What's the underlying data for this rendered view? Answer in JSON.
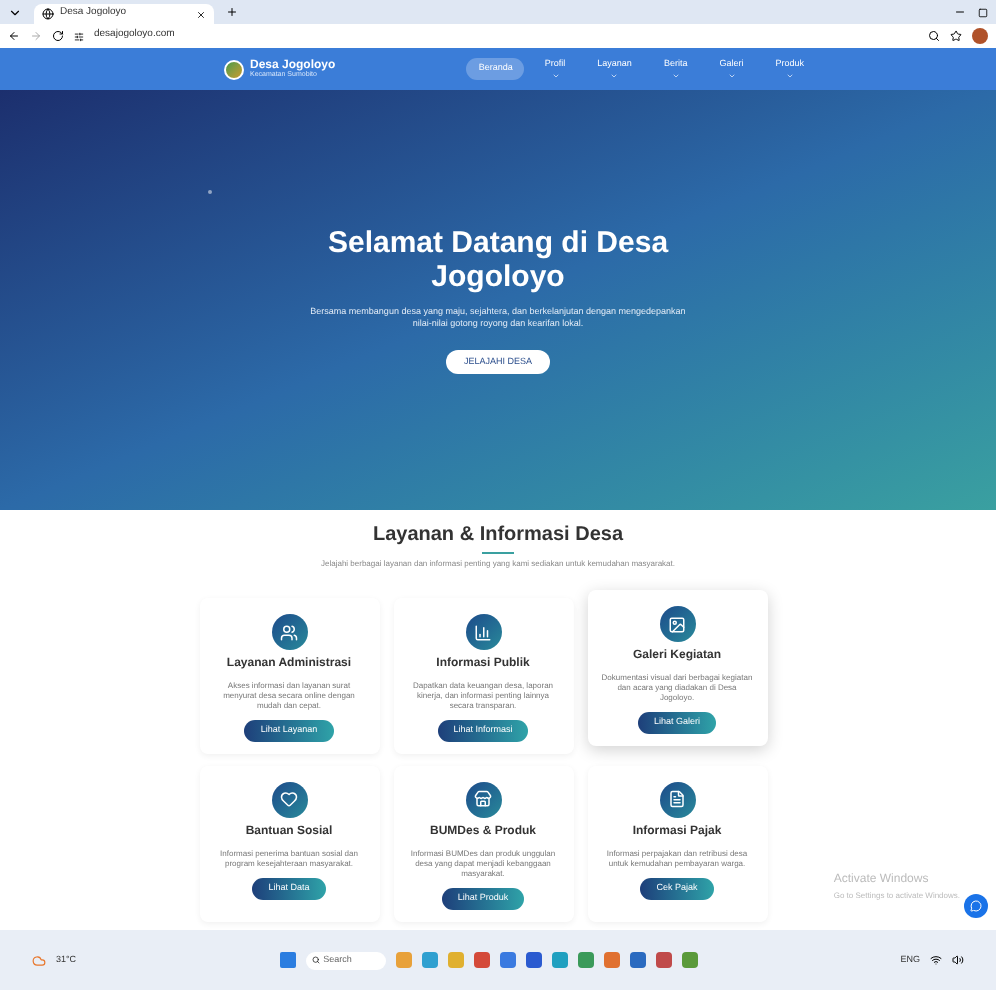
{
  "browser": {
    "tab_title": "Desa Jogoloyo",
    "url": "desajogoloyo.com"
  },
  "site": {
    "name": "Desa Jogoloyo",
    "tagline": "Kecamatan Sumobito",
    "nav": [
      {
        "label": "Beranda",
        "selected": true,
        "dropdown": false
      },
      {
        "label": "Profil",
        "selected": false,
        "dropdown": true
      },
      {
        "label": "Layanan",
        "selected": false,
        "dropdown": true
      },
      {
        "label": "Berita",
        "selected": false,
        "dropdown": true
      },
      {
        "label": "Galeri",
        "selected": false,
        "dropdown": true
      },
      {
        "label": "Produk",
        "selected": false,
        "dropdown": true
      }
    ]
  },
  "hero": {
    "title": "Selamat Datang di Desa Jogoloyo",
    "subtitle": "Bersama membangun desa yang maju, sejahtera, dan berkelanjutan dengan mengedepankan nilai-nilai gotong royong dan kearifan lokal.",
    "button": "JELAJAHI DESA"
  },
  "section": {
    "title": "Layanan & Informasi Desa",
    "subtitle": "Jelajahi berbagai layanan dan informasi penting yang kami sediakan untuk kemudahan masyarakat.",
    "cards": [
      {
        "kind": "people",
        "title": "Layanan Administrasi",
        "text": "Akses informasi dan layanan surat menyurat desa secara online dengan mudah dan cepat.",
        "button": "Lihat Layanan",
        "raised": false
      },
      {
        "kind": "chart",
        "title": "Informasi Publik",
        "text": "Dapatkan data keuangan desa, laporan kinerja, dan informasi penting lainnya secara transparan.",
        "button": "Lihat Informasi",
        "raised": false
      },
      {
        "kind": "image",
        "title": "Galeri Kegiatan",
        "text": "Dokumentasi visual dari berbagai kegiatan dan acara yang diadakan di Desa Jogoloyo.",
        "button": "Lihat Galeri",
        "raised": true
      },
      {
        "kind": "heart",
        "title": "Bantuan Sosial",
        "text": "Informasi penerima bantuan sosial dan program kesejahteraan masyarakat.",
        "button": "Lihat Data",
        "raised": false
      },
      {
        "kind": "store",
        "title": "BUMDes & Produk",
        "text": "Informasi BUMDes dan produk unggulan desa yang dapat menjadi kebanggaan masyarakat.",
        "button": "Lihat Produk",
        "raised": false
      },
      {
        "kind": "document",
        "title": "Informasi Pajak",
        "text": "Informasi perpajakan dan retribusi desa untuk kemudahan pembayaran warga.",
        "button": "Cek Pajak",
        "raised": false
      }
    ]
  },
  "windows_notice": {
    "title": "Activate Windows",
    "text": "Go to Settings to activate Windows."
  },
  "taskbar": {
    "weather": "31°C",
    "search_placeholder": "Search",
    "language": "ENG"
  }
}
